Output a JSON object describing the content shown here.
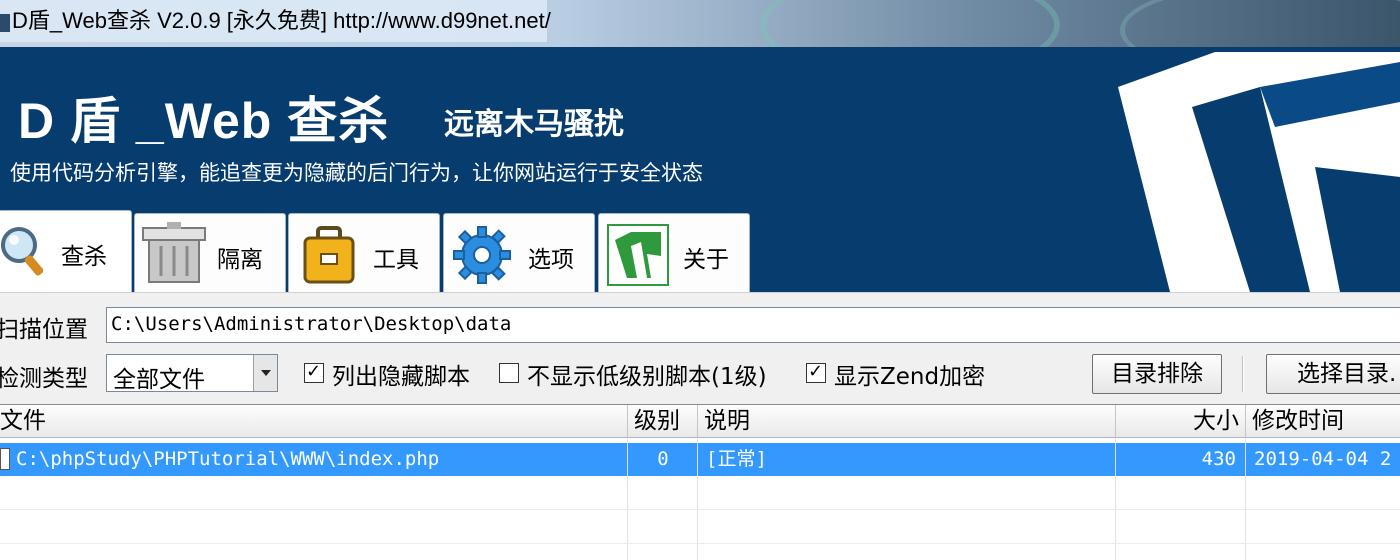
{
  "window": {
    "title": "D盾_Web查杀 V2.0.9 [永久免费] http://www.d99net.net/"
  },
  "banner": {
    "brand": "D 盾 _Web 查杀",
    "slogan": "远离木马骚扰",
    "subtitle": "使用代码分析引擎，能追查更为隐藏的后门行为，让你网站运行于安全状态",
    "colors": {
      "background": "#073c6e",
      "text": "#ffffff"
    }
  },
  "tabs": [
    {
      "label": "查杀",
      "icon": "magnifier-icon",
      "active": true
    },
    {
      "label": "隔离",
      "icon": "trash-bin-icon",
      "active": false
    },
    {
      "label": "工具",
      "icon": "briefcase-icon",
      "active": false
    },
    {
      "label": "选项",
      "icon": "gear-icon",
      "active": false
    },
    {
      "label": "关于",
      "icon": "d-logo-icon",
      "active": false
    }
  ],
  "scan": {
    "location_label": "扫描位置",
    "location_value": "C:\\Users\\Administrator\\Desktop\\data",
    "type_label": "检测类型",
    "type_value": "全部文件",
    "options": [
      {
        "label": "列出隐藏脚本",
        "checked": true
      },
      {
        "label": "不显示低级别脚本(1级)",
        "checked": false
      },
      {
        "label": "显示Zend加密",
        "checked": true
      }
    ],
    "exclude_button": "目录排除",
    "select_dir_button": "选择目录."
  },
  "results": {
    "columns": [
      "文件",
      "级别",
      "说明",
      "大小",
      "修改时间"
    ],
    "rows": [
      {
        "file": "C:\\phpStudy\\PHPTutorial\\WWW\\index.php",
        "level": "0",
        "desc": "[正常]",
        "size": "430",
        "mtime": "2019-04-04 2",
        "selected": true
      }
    ],
    "colors": {
      "selection": "#3399ff"
    }
  }
}
